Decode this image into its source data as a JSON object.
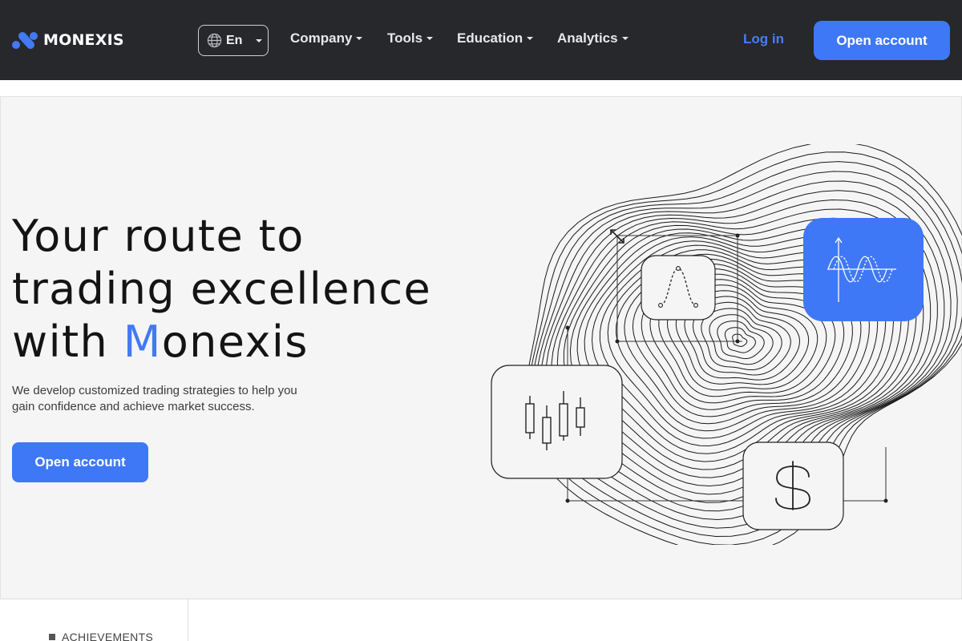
{
  "header": {
    "brand": "MONEXIS",
    "language": "En",
    "nav": [
      {
        "label": "Company"
      },
      {
        "label": "Tools"
      },
      {
        "label": "Education"
      },
      {
        "label": "Analytics"
      }
    ],
    "login_label": "Log in",
    "open_account_label": "Open account"
  },
  "hero": {
    "headline_line1": "Your route to",
    "headline_line2": "trading excellence",
    "headline_line3_prefix": "with ",
    "headline_line3_highlight": "M",
    "headline_line3_suffix": "onexis",
    "subtitle": "We develop customized trading strategies to help you gain confidence and achieve market success.",
    "cta_label": "Open account"
  },
  "illustration": {
    "icons": [
      "bell-curve-icon",
      "wave-chart-icon",
      "candlestick-icon",
      "dollar-icon",
      "expand-arrows-icon"
    ]
  },
  "section": {
    "achievements_label": "ACHIEVEMENTS"
  },
  "colors": {
    "header_bg": "#27282c",
    "accent": "#3f78f6",
    "hero_bg": "#f5f5f5"
  }
}
